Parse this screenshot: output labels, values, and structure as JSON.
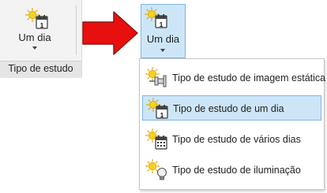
{
  "ribbon": {
    "button_label": "Um dia",
    "group_label": "Tipo de estudo"
  },
  "active_button": {
    "label": "Um dia"
  },
  "calendar_day_number": "1",
  "menu": {
    "items": [
      {
        "label": "Tipo de estudo de imagem estática",
        "icon": "sun-pushpin-icon",
        "selected": false
      },
      {
        "label": "Tipo de estudo de um dia",
        "icon": "sun-calendar-icon",
        "selected": true
      },
      {
        "label": "Tipo de estudo de vários dias",
        "icon": "sun-calendar-grid-icon",
        "selected": false
      },
      {
        "label": "Tipo de estudo de iluminação",
        "icon": "sun-lightbulb-icon",
        "selected": false
      }
    ]
  },
  "colors": {
    "highlight_bg": "#cde6f7",
    "highlight_border": "#7eb4ea",
    "arrow_red": "#e8100e",
    "sun_yellow": "#f7d21a"
  }
}
